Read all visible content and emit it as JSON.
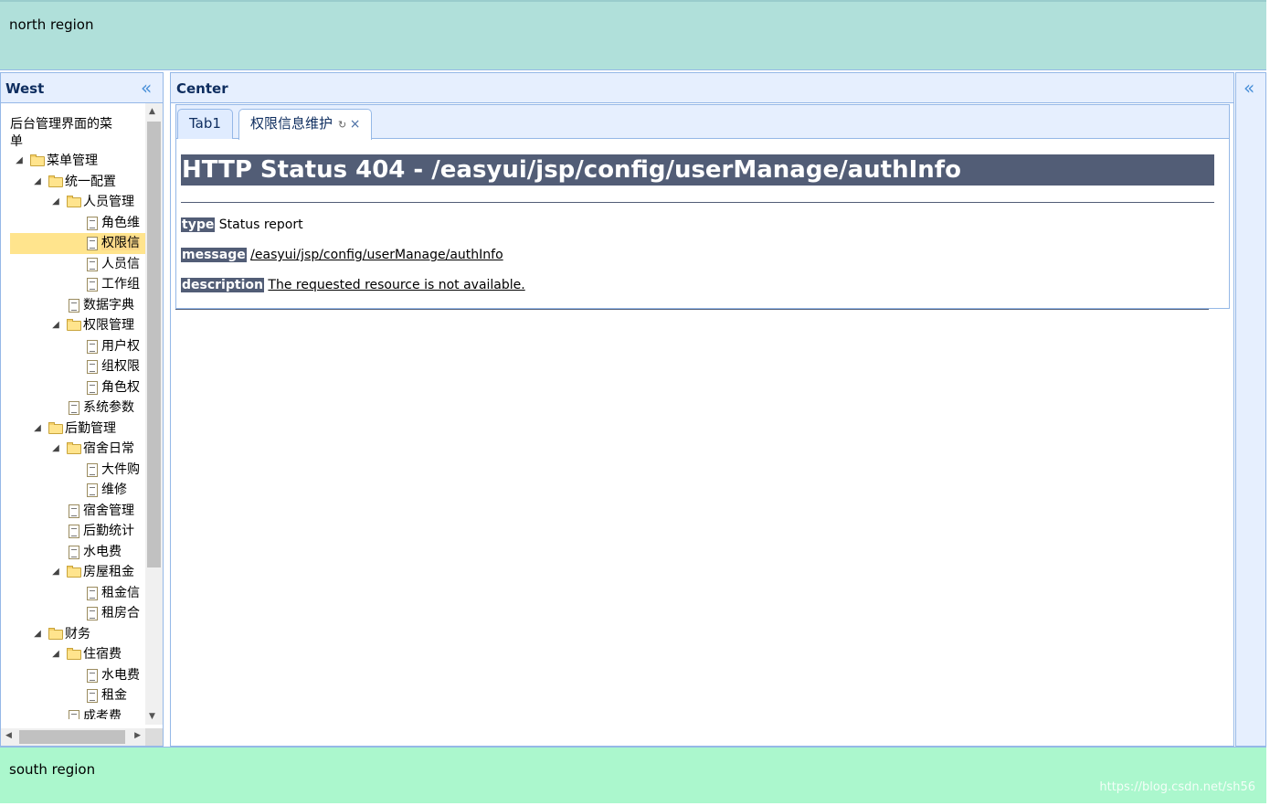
{
  "north": {
    "label": "north region"
  },
  "south": {
    "label": "south region",
    "watermark": "https://blog.csdn.net/sh56"
  },
  "west": {
    "title": "West",
    "tree": {
      "root_label": "后台管理界面的菜单",
      "nodes": [
        {
          "label": "菜单管理",
          "level": 1,
          "type": "folder",
          "expanded": true
        },
        {
          "label": "统一配置",
          "level": 2,
          "type": "folder",
          "expanded": true
        },
        {
          "label": "人员管理",
          "level": 3,
          "type": "folder",
          "expanded": true
        },
        {
          "label": "角色维",
          "level": 4,
          "type": "file"
        },
        {
          "label": "权限信",
          "level": 4,
          "type": "file",
          "selected": true
        },
        {
          "label": "人员信",
          "level": 4,
          "type": "file"
        },
        {
          "label": "工作组",
          "level": 4,
          "type": "file"
        },
        {
          "label": "数据字典",
          "level": 3,
          "type": "file"
        },
        {
          "label": "权限管理",
          "level": 3,
          "type": "folder",
          "expanded": true
        },
        {
          "label": "用户权",
          "level": 4,
          "type": "file"
        },
        {
          "label": "组权限",
          "level": 4,
          "type": "file"
        },
        {
          "label": "角色权",
          "level": 4,
          "type": "file"
        },
        {
          "label": "系统参数",
          "level": 3,
          "type": "file"
        },
        {
          "label": "后勤管理",
          "level": 2,
          "type": "folder",
          "expanded": true
        },
        {
          "label": "宿舍日常",
          "level": 3,
          "type": "folder",
          "expanded": true
        },
        {
          "label": "大件购",
          "level": 4,
          "type": "file"
        },
        {
          "label": "维修",
          "level": 4,
          "type": "file"
        },
        {
          "label": "宿舍管理",
          "level": 3,
          "type": "file"
        },
        {
          "label": "后勤统计",
          "level": 3,
          "type": "file"
        },
        {
          "label": "水电费",
          "level": 3,
          "type": "file"
        },
        {
          "label": "房屋租金",
          "level": 3,
          "type": "folder",
          "expanded": true
        },
        {
          "label": "租金信",
          "level": 4,
          "type": "file"
        },
        {
          "label": "租房合",
          "level": 4,
          "type": "file"
        },
        {
          "label": "财务",
          "level": 2,
          "type": "folder",
          "expanded": true
        },
        {
          "label": "住宿费",
          "level": 3,
          "type": "folder",
          "expanded": true
        },
        {
          "label": "水电费",
          "level": 4,
          "type": "file"
        },
        {
          "label": "租金",
          "level": 4,
          "type": "file"
        },
        {
          "label": "成考费",
          "level": 3,
          "type": "file"
        }
      ]
    }
  },
  "center": {
    "title": "Center",
    "tabs": [
      {
        "label": "Tab1",
        "active": false
      },
      {
        "label": "权限信息维护",
        "active": true,
        "refresh_icon": "↻",
        "close_icon": "×"
      }
    ],
    "error": {
      "heading": "HTTP Status 404 - /easyui/jsp/config/userManage/authInfo",
      "type_label": "type",
      "type_value": "Status report",
      "message_label": "message",
      "message_value": "/easyui/jsp/config/userManage/authInfo",
      "description_label": "description",
      "description_value": "The requested resource is not available."
    }
  },
  "icons": {
    "collapse": "«"
  },
  "colors": {
    "north_bg": "#b0e0da",
    "south_bg": "#abf7cd",
    "panel_header": "#e6effe",
    "border": "#95b8e7",
    "selected": "#ffe48d",
    "error_bar": "#525d76"
  }
}
